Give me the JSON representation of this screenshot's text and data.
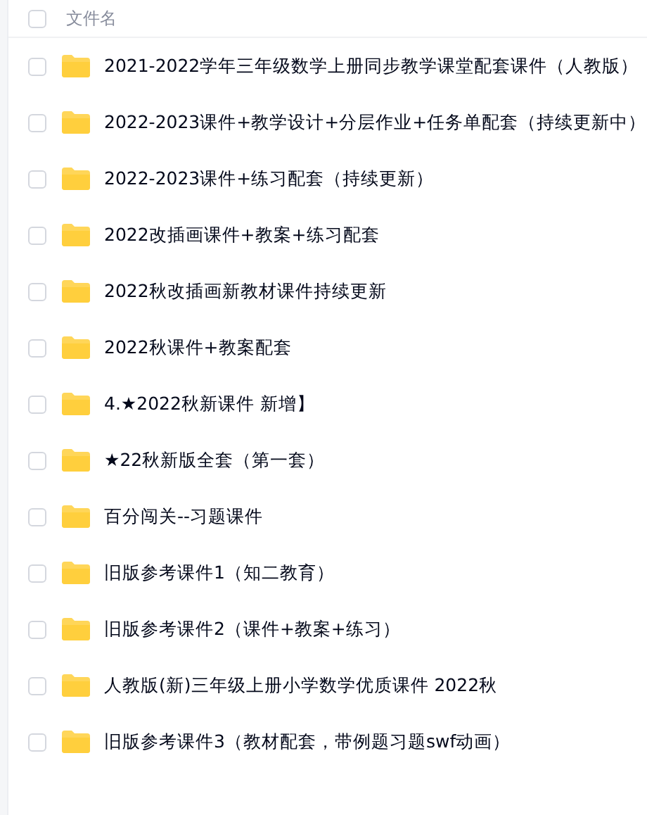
{
  "header": {
    "checked": false,
    "label": "文件名"
  },
  "files": [
    {
      "name": "2021-2022学年三年级数学上册同步教学课堂配套课件（人教版）",
      "checked": false
    },
    {
      "name": "2022-2023课件+教学设计+分层作业+任务单配套（持续更新中）",
      "checked": false
    },
    {
      "name": "2022-2023课件+练习配套（持续更新）",
      "checked": false
    },
    {
      "name": "2022改插画课件+教案+练习配套",
      "checked": false
    },
    {
      "name": "2022秋改插画新教材课件持续更新",
      "checked": false
    },
    {
      "name": "2022秋课件+教案配套",
      "checked": false
    },
    {
      "name": "4.★2022秋新课件 新增】",
      "checked": false
    },
    {
      "name": "★22秋新版全套（第一套）",
      "checked": false
    },
    {
      "name": "百分闯关--习题课件",
      "checked": false
    },
    {
      "name": "旧版参考课件1（知二教育）",
      "checked": false
    },
    {
      "name": "旧版参考课件2（课件+教案+练习）",
      "checked": false
    },
    {
      "name": "人教版(新)三年级上册小学数学优质课件 2022秋",
      "checked": false
    },
    {
      "name": "旧版参考课件3（教材配套，带例题习题swf动画）",
      "checked": false
    }
  ]
}
